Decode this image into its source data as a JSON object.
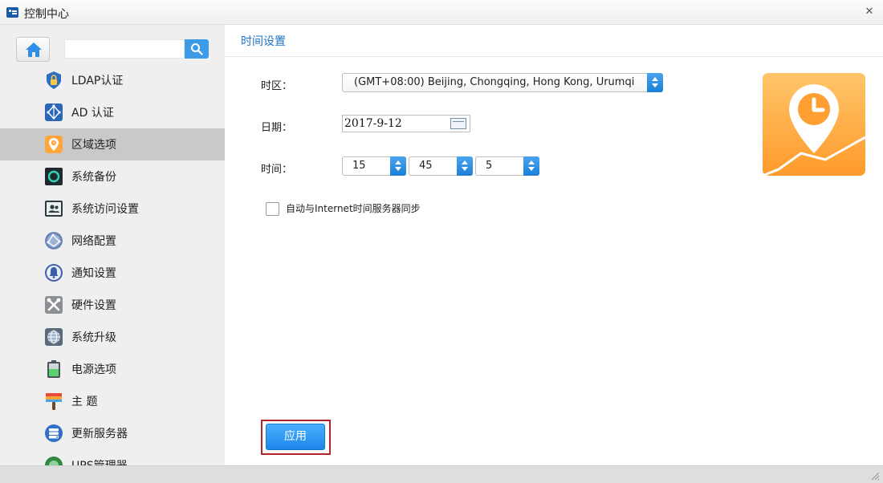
{
  "window": {
    "title": "控制中心"
  },
  "sidebar": {
    "search": {
      "value": "",
      "placeholder": ""
    },
    "items": [
      {
        "label": "LDAP认证",
        "icon": "ldap-lock-icon",
        "active": false
      },
      {
        "label": "AD 认证",
        "icon": "ad-network-icon",
        "active": false
      },
      {
        "label": "区域选项",
        "icon": "region-pin-icon",
        "active": true
      },
      {
        "label": "系统备份",
        "icon": "backup-icon",
        "active": false
      },
      {
        "label": "系统访问设置",
        "icon": "access-users-icon",
        "active": false
      },
      {
        "label": "网络配置",
        "icon": "network-globe-icon",
        "active": false
      },
      {
        "label": "通知设置",
        "icon": "bell-icon",
        "active": false
      },
      {
        "label": "硬件设置",
        "icon": "tools-icon",
        "active": false
      },
      {
        "label": "系统升级",
        "icon": "upgrade-globe-icon",
        "active": false
      },
      {
        "label": "电源选项",
        "icon": "battery-icon",
        "active": false
      },
      {
        "label": "主 题",
        "icon": "theme-brush-icon",
        "active": false
      },
      {
        "label": "更新服务器",
        "icon": "update-server-icon",
        "active": false
      },
      {
        "label": "UPS管理器",
        "icon": "ups-icon",
        "active": false
      }
    ]
  },
  "main": {
    "section_title": "时间设置",
    "timezone": {
      "label": "时区：",
      "value": "(GMT+08:00) Beijing, Chongqing, Hong Kong, Urumqi"
    },
    "date": {
      "label": "日期：",
      "value": "2017-9-12"
    },
    "time": {
      "label": "时间：",
      "hour": "15",
      "minute": "45",
      "second": "5"
    },
    "sync": {
      "label": "自动与Internet时间服务器同步",
      "checked": false
    },
    "apply_label": "应用"
  },
  "colors": {
    "accent": "#1f73c7",
    "button": "#2f98f2",
    "highlight_frame": "#b3232a",
    "hero_orange": "#ffa53c"
  }
}
